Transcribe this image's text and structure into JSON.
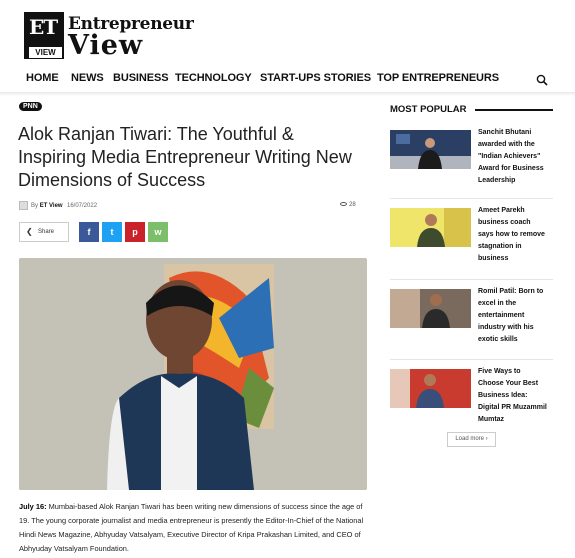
{
  "logo": {
    "mark_text": "ET",
    "mark_sub": "VIEW",
    "word1": "Entrepreneur",
    "word2": "View"
  },
  "nav": {
    "items": [
      {
        "label": "HOME"
      },
      {
        "label": "NEWS"
      },
      {
        "label": "BUSINESS"
      },
      {
        "label": "TECHNOLOGY"
      },
      {
        "label": "START-UPS STORIES"
      },
      {
        "label": "TOP ENTREPRENEURS"
      }
    ],
    "search_icon": "search-icon"
  },
  "article": {
    "category_badge": "PNN",
    "title": "Alok Ranjan Tiwari: The Youthful & Inspiring Media Entrepreneur Writing New Dimensions of Success",
    "by_prefix": "By",
    "author": "ET View",
    "date": "16/07/2022",
    "views": "28",
    "share_label": "Share",
    "social": [
      {
        "name": "facebook",
        "glyph": "f",
        "color": "#3b5998"
      },
      {
        "name": "twitter",
        "glyph": "t",
        "color": "#1da1f2"
      },
      {
        "name": "pinterest",
        "glyph": "p",
        "color": "#ca212a"
      },
      {
        "name": "whatsapp",
        "glyph": "w",
        "color": "#7bbf6a"
      }
    ],
    "dateline": "July 16:",
    "body": "Mumbai-based Alok Ranjan Tiwari has been writing new dimensions of success since the age of 19. The young corporate journalist and media entrepreneur is presently the Editor-In-Chief of the National Hindi News Magazine, Abhyuday Vatsalyam, Executive Director of Kripa Prakashan Limited, and CEO of Abhyuday Vatsalyam Foundation."
  },
  "sidebar": {
    "heading": "MOST POPULAR",
    "items": [
      {
        "title": "Sanchit Bhutani awarded with the \"Indian Achievers\" Award for Business Leadership"
      },
      {
        "title": "Ameet Parekh business coach says how to remove stagnation in business"
      },
      {
        "title": "Romil Patil: Born to excel in the entertainment industry with his exotic skills"
      },
      {
        "title": "Five Ways to Choose Your Best Business Idea: Digital PR Muzammil Mumtaz"
      }
    ],
    "load_more": "Load more"
  }
}
